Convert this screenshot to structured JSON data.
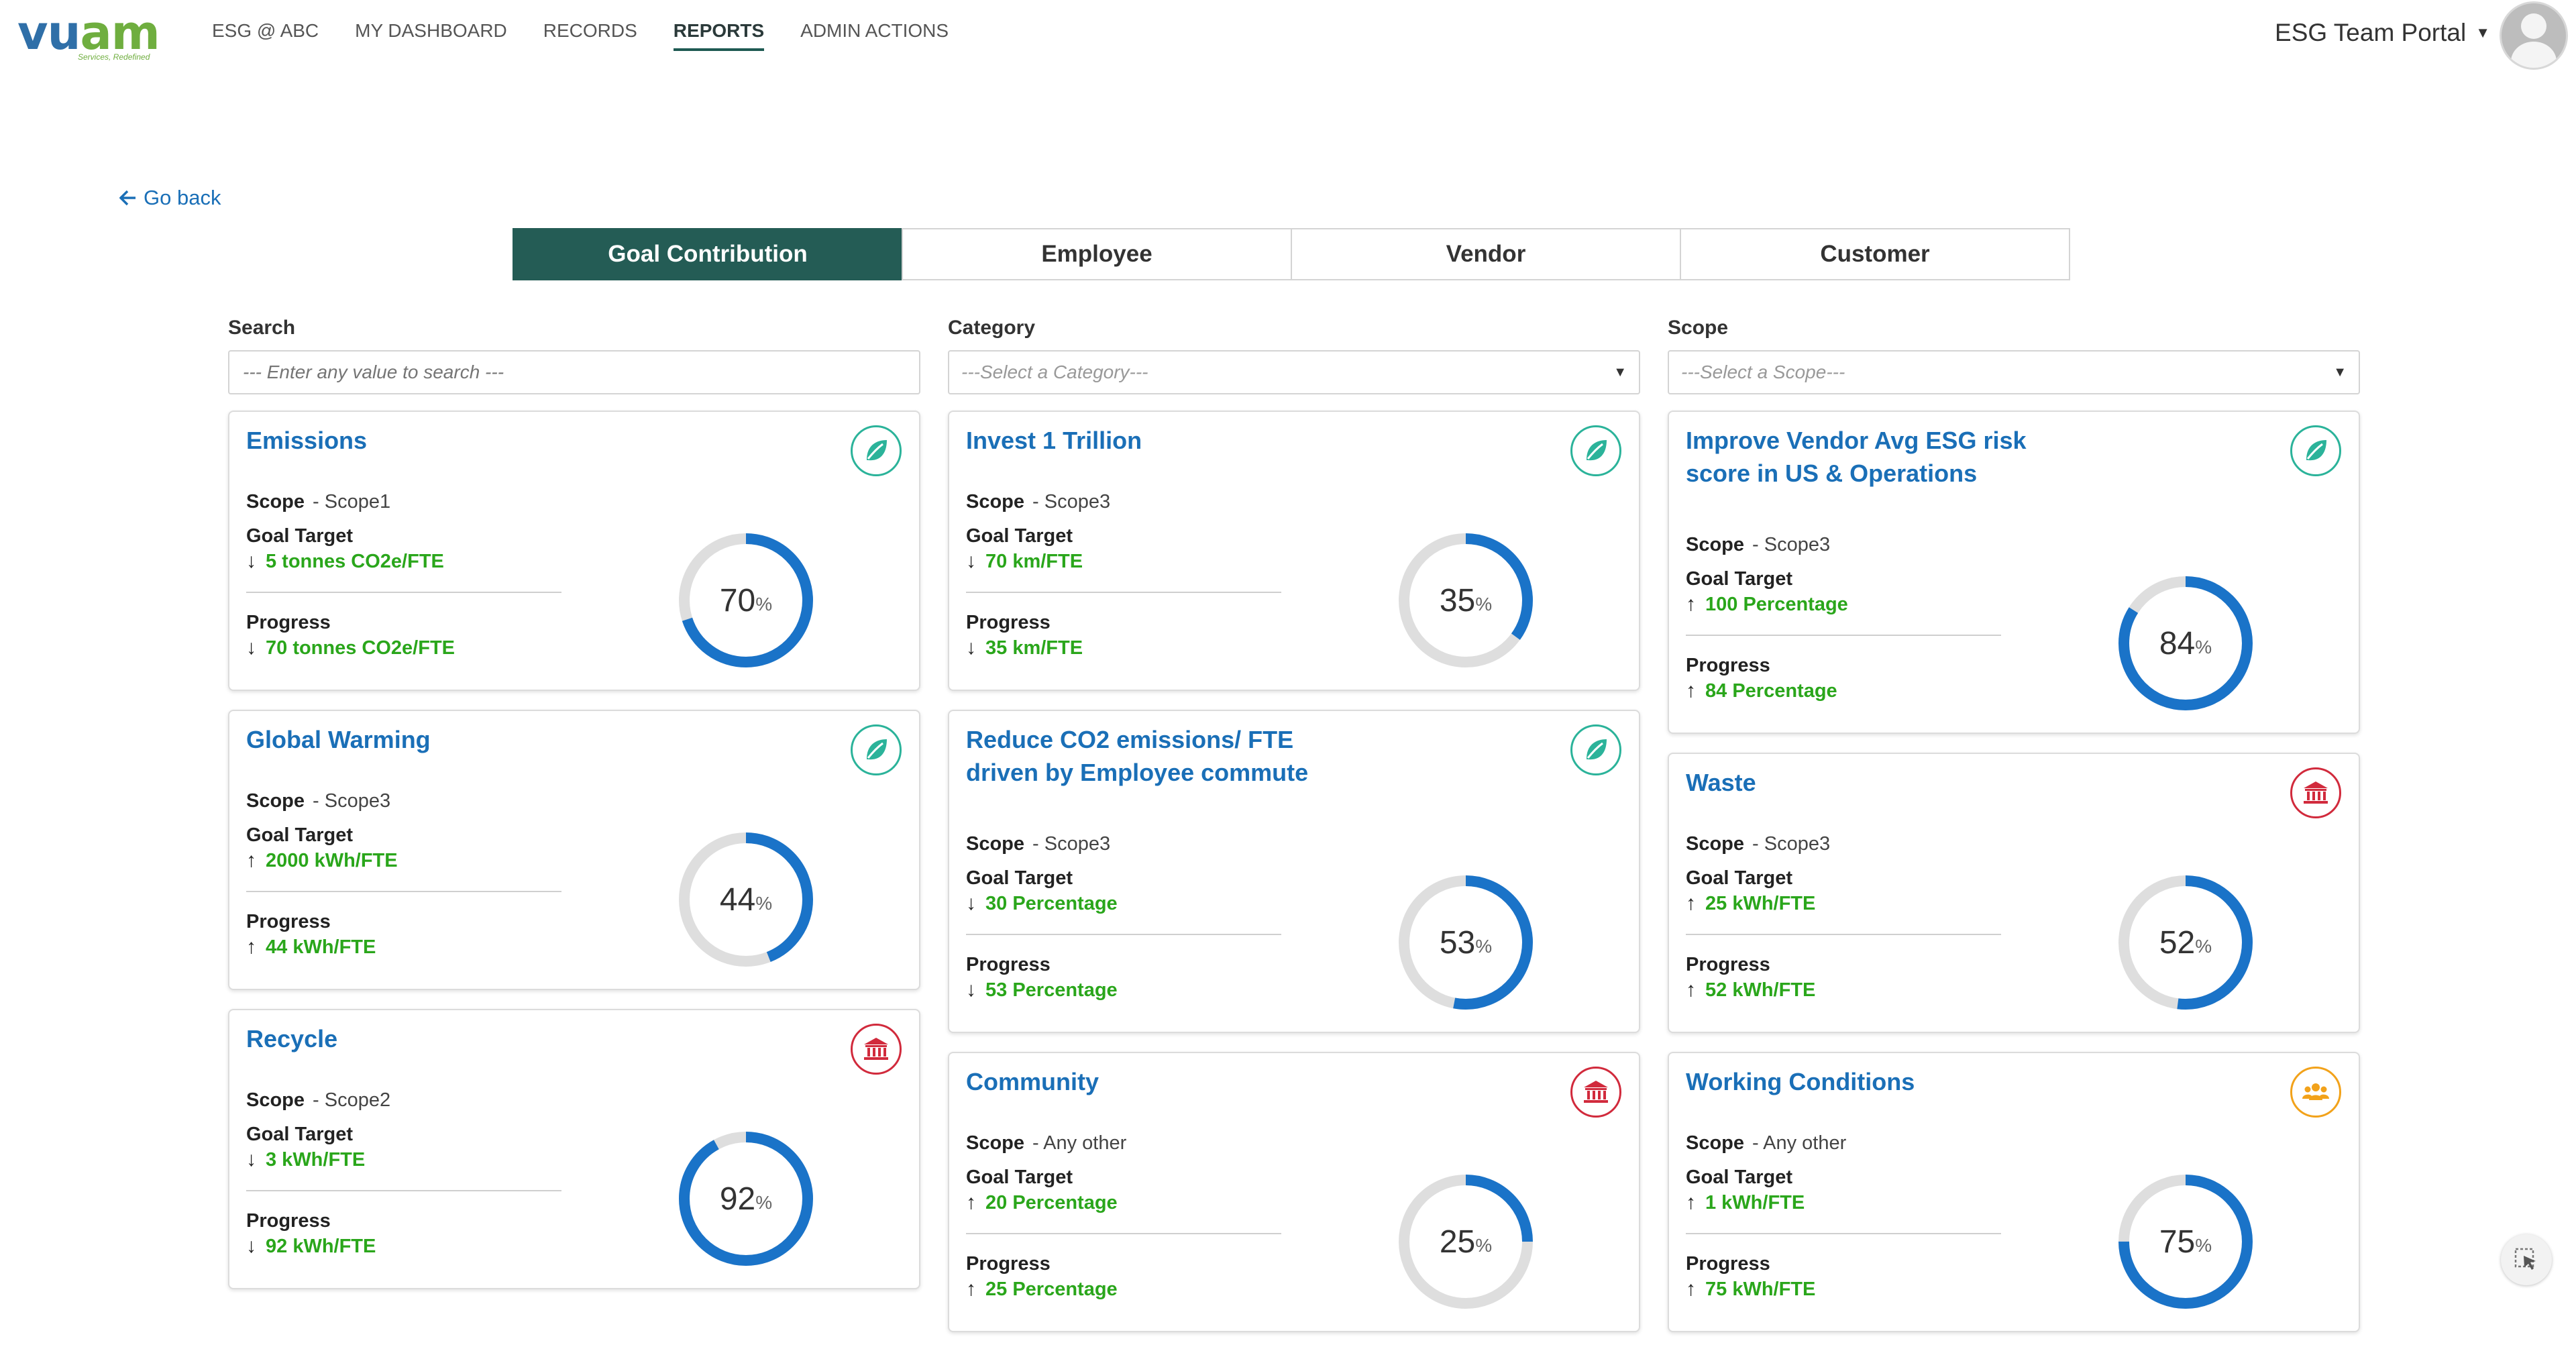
{
  "brand": {
    "logo_main": "vu",
    "logo_accent": "am",
    "logo_tagline": "Services, Redefined"
  },
  "nav": [
    {
      "label": "ESG @ ABC",
      "active": false
    },
    {
      "label": "MY DASHBOARD",
      "active": false
    },
    {
      "label": "RECORDS",
      "active": false
    },
    {
      "label": "REPORTS",
      "active": true
    },
    {
      "label": "ADMIN ACTIONS",
      "active": false
    }
  ],
  "portal": {
    "label": "ESG Team Portal"
  },
  "go_back": {
    "label": "Go back"
  },
  "tabs": [
    {
      "label": "Goal Contribution",
      "active": true
    },
    {
      "label": "Employee",
      "active": false
    },
    {
      "label": "Vendor",
      "active": false
    },
    {
      "label": "Customer",
      "active": false
    }
  ],
  "filters": {
    "search": {
      "label": "Search",
      "placeholder": "--- Enter any value to search ---"
    },
    "category": {
      "label": "Category",
      "value": "---Select a Category---"
    },
    "scope": {
      "label": "Scope",
      "value": "---Select a Scope---"
    }
  },
  "labels": {
    "scope": "Scope",
    "goal_target": "Goal Target",
    "progress": "Progress"
  },
  "colors": {
    "primary_tab": "#245c55",
    "link": "#1a6fb7",
    "value_green": "#2aa61b",
    "donut_fill": "#1a73c8",
    "donut_track": "#dedede"
  },
  "cards": {
    "col1": [
      {
        "title": "Emissions",
        "icon": "leaf-icon",
        "scope": "- Scope1",
        "target_dir": "down",
        "target": "5 tonnes CO2e/FTE",
        "progress_dir": "down",
        "progress_value": "70 tonnes CO2e/FTE",
        "percent": 70
      },
      {
        "title": "Global Warming",
        "icon": "leaf-icon",
        "scope": "- Scope3",
        "target_dir": "up",
        "target": "2000 kWh/FTE",
        "progress_dir": "up",
        "progress_value": "44 kWh/FTE",
        "percent": 44
      },
      {
        "title": "Recycle",
        "icon": "bank-icon",
        "scope": "- Scope2",
        "target_dir": "down",
        "target": "3 kWh/FTE",
        "progress_dir": "down",
        "progress_value": "92 kWh/FTE",
        "percent": 92
      }
    ],
    "col2": [
      {
        "title": "Invest 1 Trillion",
        "icon": "leaf-icon",
        "scope": "- Scope3",
        "target_dir": "down",
        "target": "70 km/FTE",
        "progress_dir": "down",
        "progress_value": "35 km/FTE",
        "percent": 35
      },
      {
        "title": "Reduce CO2 emissions/ FTE driven by Employee commute",
        "icon": "leaf-icon",
        "scope": "- Scope3",
        "target_dir": "down",
        "target": "30 Percentage",
        "progress_dir": "down",
        "progress_value": "53 Percentage",
        "percent": 53
      },
      {
        "title": "Community",
        "icon": "bank-icon",
        "scope": "- Any other",
        "target_dir": "up",
        "target": "20 Percentage",
        "progress_dir": "up",
        "progress_value": "25 Percentage",
        "percent": 25
      }
    ],
    "col3": [
      {
        "title": "Improve Vendor Avg ESG risk score in US & Operations",
        "icon": "leaf-icon",
        "scope": "- Scope3",
        "target_dir": "up",
        "target": "100 Percentage",
        "progress_dir": "up",
        "progress_value": "84 Percentage",
        "percent": 84
      },
      {
        "title": "Waste",
        "icon": "bank-icon",
        "scope": "- Scope3",
        "target_dir": "up",
        "target": "25 kWh/FTE",
        "progress_dir": "up",
        "progress_value": "52 kWh/FTE",
        "percent": 52
      },
      {
        "title": "Working Conditions",
        "icon": "people-icon",
        "scope": "- Any other",
        "target_dir": "up",
        "target": "1 kWh/FTE",
        "progress_dir": "up",
        "progress_value": "75 kWh/FTE",
        "percent": 75
      }
    ]
  }
}
